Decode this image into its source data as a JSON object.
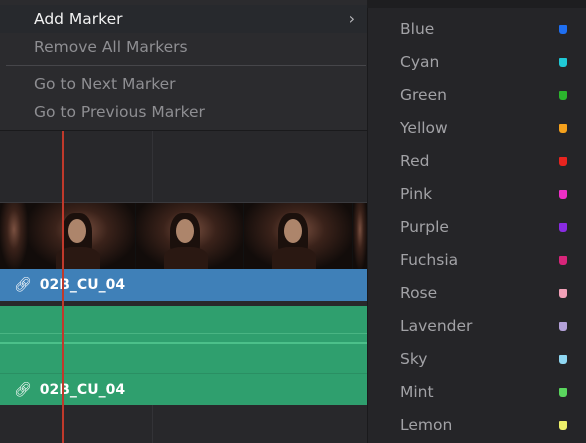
{
  "context_menu": {
    "items": [
      {
        "label": "Add Marker",
        "has_submenu": true,
        "active": true
      },
      {
        "label": "Remove All Markers"
      },
      {
        "label": "Go to Next Marker"
      },
      {
        "label": "Go to Previous Marker"
      }
    ],
    "submenu_arrow": "chevron-right-icon"
  },
  "timeline": {
    "video_clip": {
      "name": "02B_CU_04",
      "icon": "link-icon",
      "color": "#3f80b8"
    },
    "audio_clip": {
      "name": "02B_CU_04",
      "icon": "link-icon",
      "color": "#2f9f6e"
    },
    "playhead_color": "#c0392b"
  },
  "marker_colors": [
    {
      "label": "Blue",
      "color": "#1f6ff2"
    },
    {
      "label": "Cyan",
      "color": "#20c9d6"
    },
    {
      "label": "Green",
      "color": "#2bb52d"
    },
    {
      "label": "Yellow",
      "color": "#f5a11c"
    },
    {
      "label": "Red",
      "color": "#e8241f"
    },
    {
      "label": "Pink",
      "color": "#ee2fc7"
    },
    {
      "label": "Purple",
      "color": "#8a2be2"
    },
    {
      "label": "Fuchsia",
      "color": "#d8257a"
    },
    {
      "label": "Rose",
      "color": "#f2a1b8"
    },
    {
      "label": "Lavender",
      "color": "#b3a1d8"
    },
    {
      "label": "Sky",
      "color": "#8fd7f2"
    },
    {
      "label": "Mint",
      "color": "#5ad65e"
    },
    {
      "label": "Lemon",
      "color": "#eef06a"
    }
  ]
}
